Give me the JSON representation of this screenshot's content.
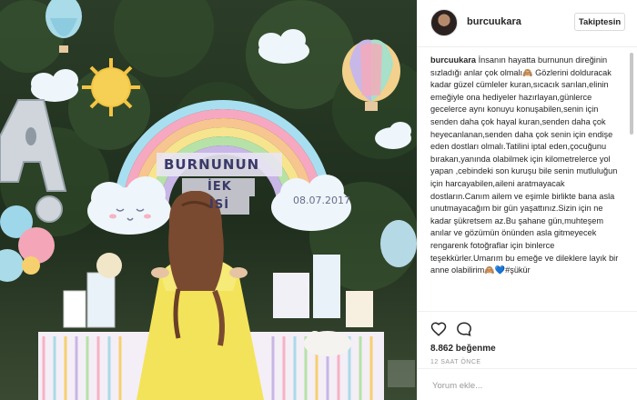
{
  "photo": {
    "banner_line1": "BURNUNUN",
    "banner_line2": "İEK",
    "banner_line3": "İSİ",
    "date": "08.07.2017"
  },
  "post": {
    "username": "burcuukara",
    "follow_label": "Takiptesin",
    "caption_user": "burcuukara",
    "caption_text": "İnsanın hayatta burnunun direğinin sızladığı anlar çok olmalı🙈 Gözlerini dolduracak kadar güzel cümleler kuran,sıcacık sarılan,elinin emeğiyle ona hediyeler hazırlayan,günlerce gecelerce aynı konuyu konuşabilen,senin için senden daha çok hayal kuran,senden daha çok heyecanlanan,senden daha çok senin için endişe eden dostları olmalı.Tatilini iptal eden,çocuğunu bırakan,yanında olabilmek için kilometrelerce yol yapan ,cebindeki son kuruşu bile senin mutluluğun için harcayabilen,aileni aratmayacak dostların.Canım ailem ve eşimle birlikte bana asla unutmayacağım bir gün yaşattınız.Sizin için ne kadar şükretsem az.Bu şahane gün,muhteşem anılar ve gözümün önünden asla gitmeyecek rengarenk fotoğraflar için binlerce teşekkürler.Umarım bu emeğe ve dileklere layık bir anne olabilirim🙈💙#şükür",
    "likes": "8.862 beğenme",
    "time": "12 SAAT ÖNCE",
    "comment_placeholder": "Yorum ekle..."
  },
  "icons": {
    "like": "heart-icon",
    "comment": "comment-icon"
  }
}
